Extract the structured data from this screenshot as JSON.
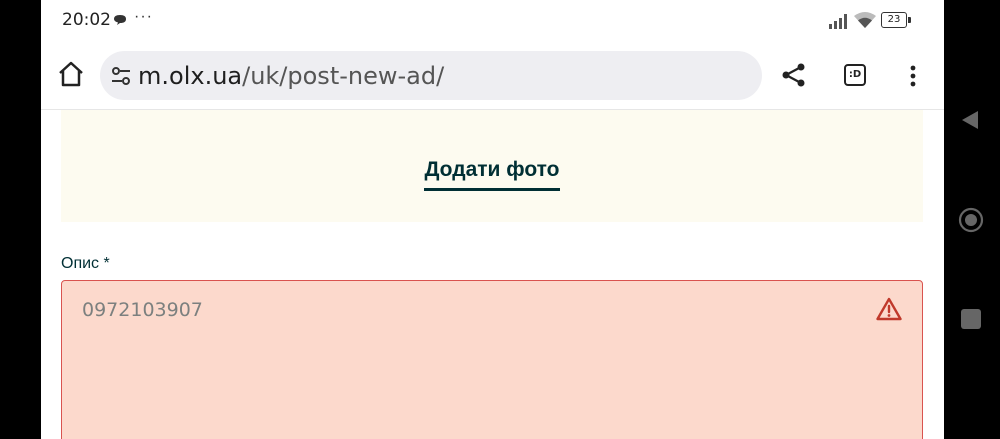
{
  "status_bar": {
    "time": "20:02",
    "overflow": "···",
    "battery": "23",
    "icons": [
      "chat-icon",
      "signal-icon",
      "wifi-icon",
      "battery-icon"
    ]
  },
  "browser": {
    "url_host": "m.olx.ua",
    "url_path": "/uk/post-new-ad/",
    "tab_label": ":D",
    "icons": [
      "home-icon",
      "site-settings-icon",
      "share-icon",
      "tab-switcher-icon",
      "more-vert-icon"
    ]
  },
  "form": {
    "add_photo_label": "Додати фото",
    "description_label": "Опис *",
    "description_value": "0972103907",
    "error_icon": "warning-icon"
  },
  "colors": {
    "accent": "#002f34",
    "error_bg": "#fcd9cc",
    "error_border": "#d9534f",
    "photo_bg": "#fdfbf0"
  },
  "nav_bar": {
    "icons": [
      "back-icon",
      "home-circle-icon",
      "recents-icon"
    ]
  }
}
